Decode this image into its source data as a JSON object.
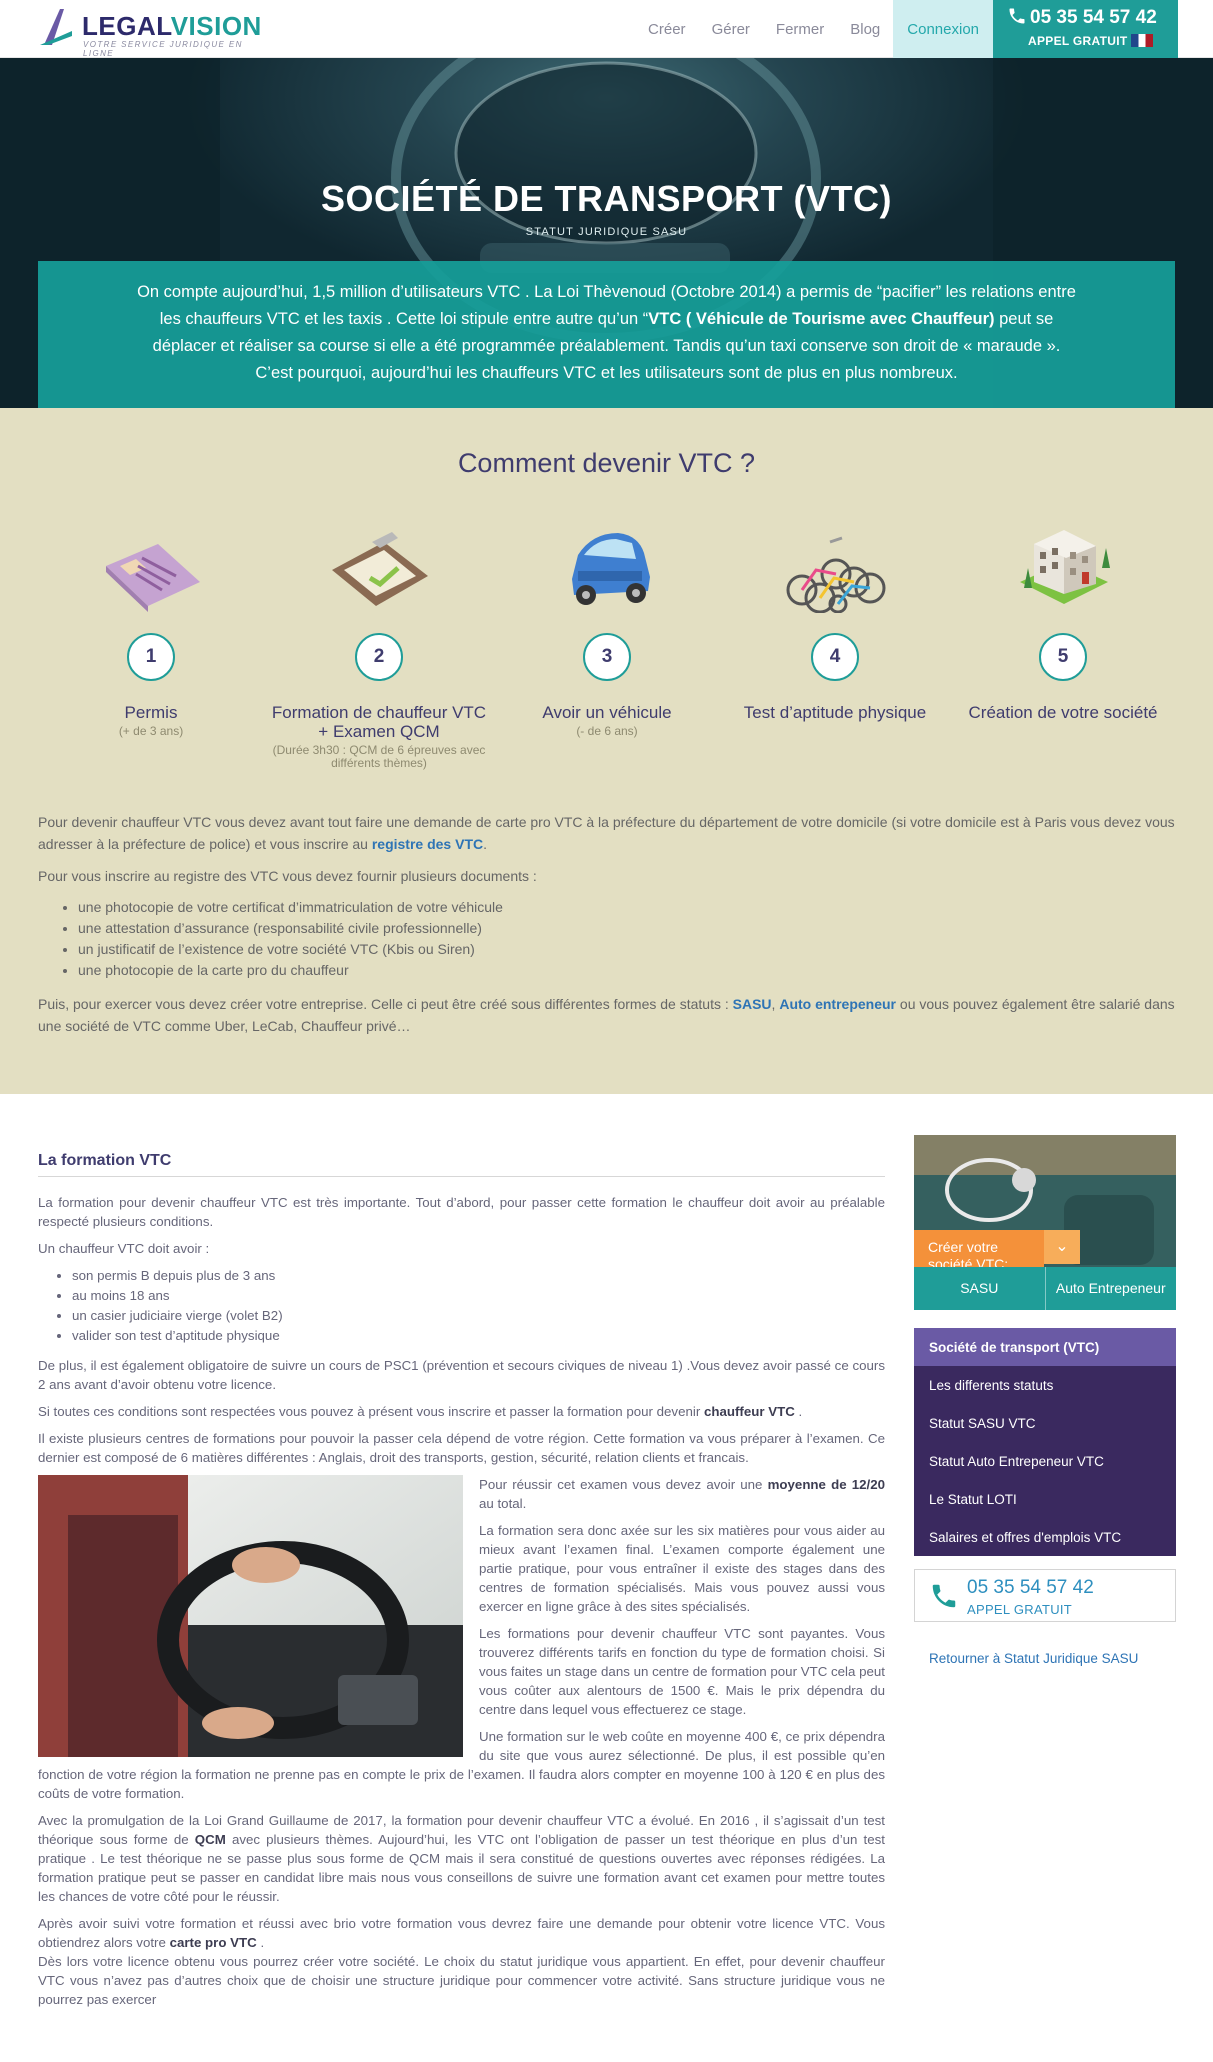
{
  "header": {
    "logo_part1": "LEGAL",
    "logo_part2": "VISION",
    "logo_tagline": "VOTRE SERVICE JURIDIQUE EN LIGNE",
    "nav": [
      "Créer",
      "Gérer",
      "Fermer",
      "Blog"
    ],
    "connexion": "Connexion",
    "phone": "05 35 54 57 42",
    "phone_sub": "APPEL GRATUIT"
  },
  "hero": {
    "title": "SOCIÉTÉ DE TRANSPORT (VTC)",
    "subtitle": "STATUT JURIDIQUE SASU",
    "intro_a": "On compte aujourd’hui, 1,5 million d’utilisateurs VTC . La Loi Thèvenoud (Octobre 2014) a permis de “pacifier” les relations entre les chauffeurs VTC et les taxis . Cette loi stipule entre autre qu’un “",
    "intro_b": "VTC ( Véhicule de Tourisme avec Chauffeur)",
    "intro_c": " peut se déplacer et réaliser sa course si elle a été programmée préalablement. Tandis qu’un taxi conserve son droit de « maraude ». C’est pourquoi, aujourd’hui les chauffeurs VTC et les utilisateurs sont de plus en plus nombreux."
  },
  "steps": {
    "title": "Comment devenir VTC ?",
    "items": [
      {
        "num": "1",
        "label": "Permis",
        "note": "(+ de 3 ans)",
        "icon": "license-card-icon"
      },
      {
        "num": "2",
        "label": "Formation de chauffeur VTC + Examen QCM",
        "note": "(Durée 3h30 : QCM de 6 épreuves avec différents thèmes)",
        "icon": "clipboard-icon"
      },
      {
        "num": "3",
        "label": "Avoir un véhicule",
        "note": "(- de 6 ans)",
        "icon": "car-icon"
      },
      {
        "num": "4",
        "label": "Test d’aptitude physique",
        "note": "",
        "icon": "bicycles-icon"
      },
      {
        "num": "5",
        "label": "Création de votre société",
        "note": "",
        "icon": "building-icon"
      }
    ],
    "body_p1_a": "Pour devenir chauffeur VTC vous devez avant tout faire une demande de carte pro VTC à la préfecture du département de votre domicile (si votre domicile est à Paris vous devez vous adresser à la préfecture de police) et vous inscrire  au ",
    "body_p1_link": "registre des VTC",
    "body_p1_b": ".",
    "body_p2": "Pour vous inscrire au registre des VTC vous devez fournir plusieurs documents :",
    "documents": [
      "une photocopie de votre certificat d’immatriculation de votre véhicule",
      "une attestation d’assurance (responsabilité civile professionnelle)",
      "un justificatif de l’existence de votre société VTC (Kbis ou Siren)",
      "une photocopie de la carte pro du chauffeur"
    ],
    "body_p3_a": "Puis, pour exercer vous devez créer votre entreprise. Celle ci peut être créé sous différentes formes de statuts : ",
    "body_p3_link1": "SASU",
    "body_p3_sep": ", ",
    "body_p3_link2": "Auto entrepeneur",
    "body_p3_b": " ou vous pouvez également être salarié dans une société de VTC comme Uber, LeCab, Chauffeur privé…"
  },
  "content": {
    "heading": "La formation VTC",
    "p1": "La formation pour devenir chauffeur VTC est très importante. Tout d’abord, pour passer cette formation le chauffeur doit avoir au préalable respecté plusieurs conditions.",
    "p2": "Un chauffeur VTC doit avoir :",
    "conditions": [
      "son permis B depuis plus de 3 ans",
      "au moins 18 ans",
      "un casier judiciaire vierge (volet B2)",
      "valider son test d’aptitude physique"
    ],
    "p3": "De plus, il est également obligatoire de suivre un cours de PSC1 (prévention et secours civiques de niveau 1) .Vous devez avoir passé ce cours 2 ans avant d’avoir obtenu votre licence.",
    "p4_a": "Si toutes ces conditions sont respectées vous pouvez à présent vous inscrire et passer la formation pour devenir ",
    "p4_b": "chauffeur VTC",
    "p4_c": " .",
    "p5": "Il existe plusieurs centres de formations pour pouvoir la passer cela dépend de votre région. Cette formation va vous préparer à l’examen. Ce dernier est composé de 6 matières différentes : Anglais, droit des transports, gestion, sécurité, relation clients  et francais.",
    "p6_a": "Pour réussir cet examen vous devez avoir une ",
    "p6_b": "moyenne de 12/20",
    "p6_c": " au total.",
    "p7": "La formation sera donc axée sur les six matières pour vous aider au mieux avant l’examen final.  L’examen comporte également une partie pratique, pour vous entraîner il existe des stages dans des centres de formation spécialisés. Mais vous pouvez aussi vous exercer en ligne grâce à des sites spécialisés.",
    "p8": "Les formations pour devenir chauffeur VTC sont payantes. Vous trouverez différents tarifs en fonction du type de formation choisi. Si vous faites un stage dans un centre de formation pour VTC cela peut vous coûter aux alentours de 1500 €. Mais le prix dépendra du centre dans lequel vous effectuerez ce stage.",
    "p9": "Une formation sur le web coûte en moyenne 400 €, ce prix dépendra du site que vous aurez sélectionné.  De plus, il est possible qu’en fonction de votre région la formation ne prenne pas en compte le prix de l’examen. Il faudra alors compter en moyenne 100 à 120 € en plus des coûts de votre formation.",
    "p10_a": "Avec la promulgation de la Loi Grand Guillaume de 2017, la formation pour devenir chauffeur VTC a évolué. En 2016 , il s’agissait d’un test théorique sous forme de ",
    "p10_b": "QCM",
    "p10_c": " avec plusieurs thèmes. Aujourd’hui, les VTC ont l’obligation de passer un test théorique en plus d’un test pratique . Le test théorique ne se passe plus sous forme de QCM mais il sera constitué de questions ouvertes avec réponses rédigées. La formation pratique peut se passer en candidat libre mais nous vous conseillons de suivre une formation avant cet examen pour mettre toutes les chances de votre côté pour le réussir.",
    "p11_a": "Après avoir suivi votre formation et réussi avec brio votre formation vous devrez faire une demande pour obtenir votre licence VTC. Vous obtiendrez alors votre ",
    "p11_b": "carte pro VTC",
    "p11_c": " .",
    "p12": "Dès lors votre licence obtenu vous pourrez créer votre société. Le choix du statut juridique vous appartient. En effet, pour devenir chauffeur VTC vous n’avez pas d’autres choix que de choisir une structure juridique pour commencer votre activité. Sans structure juridique vous ne pourrez pas exercer"
  },
  "sidebar": {
    "promo_cta": "Créer votre société VTC:",
    "promo_tabs": [
      "SASU",
      "Auto Entrepeneur"
    ],
    "menu": [
      "Société de transport (VTC)",
      "Les differents statuts",
      "Statut SASU VTC",
      "Statut Auto Entrepeneur VTC",
      "Le Statut LOTI",
      "Salaires et offres d'emplois VTC"
    ],
    "phone": "05 35 54 57 42",
    "phone_sub": "APPEL GRATUIT",
    "back_link": "Retourner à Statut Juridique SASU"
  }
}
